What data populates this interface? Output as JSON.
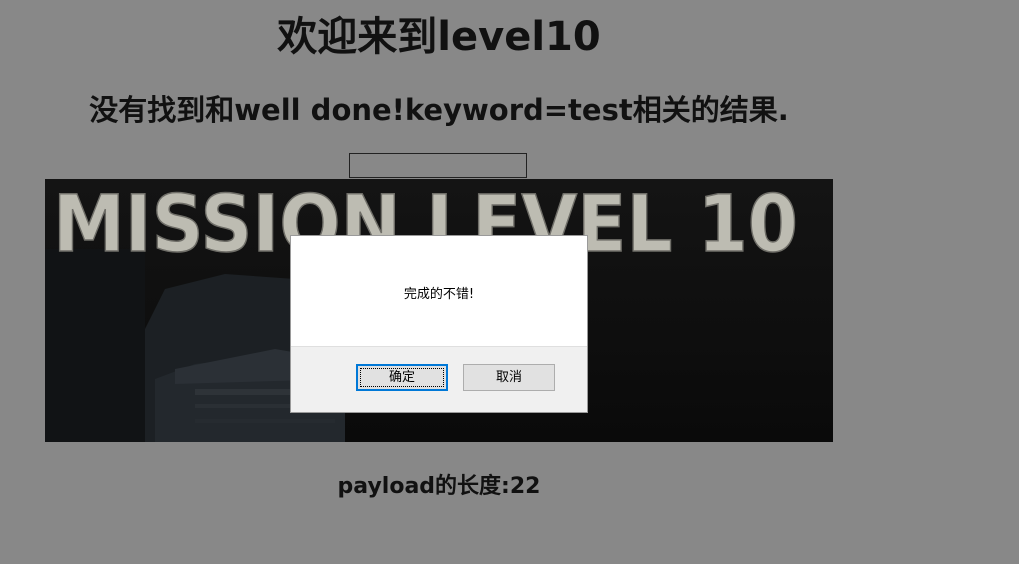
{
  "page": {
    "title": "欢迎来到level10",
    "result_message": "没有找到和well done!keyword=test相关的结果.",
    "payload_length": "payload的长度:22"
  },
  "banner": {
    "text": "MISSION LEVEL 10",
    "background_color": "#0c0c0c",
    "text_color": "#bdbcb2"
  },
  "dialog": {
    "message": "完成的不错!",
    "ok_label": "确定",
    "cancel_label": "取消"
  },
  "colors": {
    "page_background": "#888888",
    "focus_accent": "#0078d7"
  }
}
